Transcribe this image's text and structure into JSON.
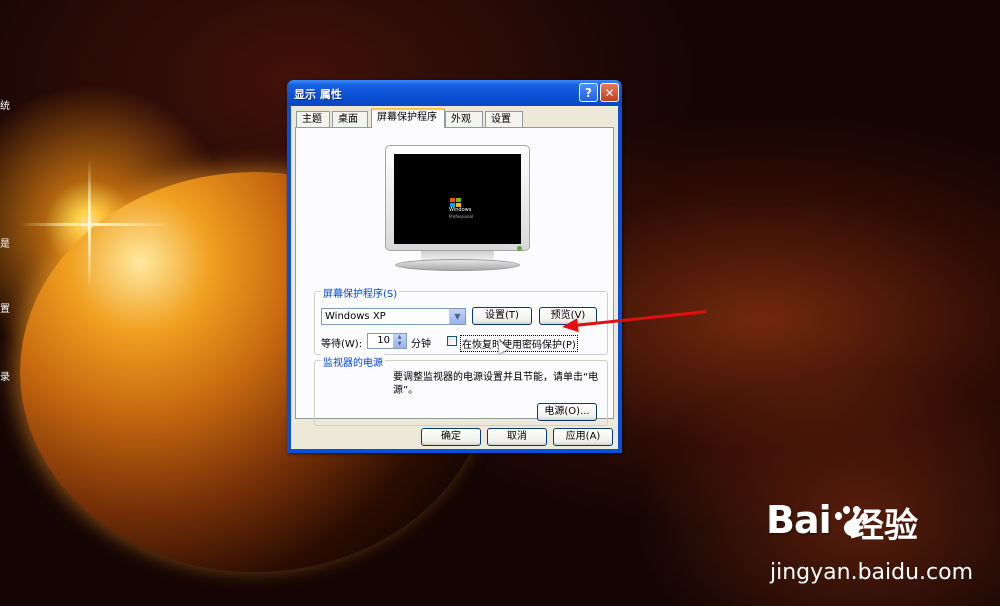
{
  "desktop": {
    "side_labels": [
      "统",
      "是",
      "置",
      "录"
    ]
  },
  "window": {
    "title": "显示 属性",
    "help_label": "?",
    "close_label": "✕",
    "tabs": [
      {
        "label": "主题",
        "active": false
      },
      {
        "label": "桌面",
        "active": false
      },
      {
        "label": "屏幕保护程序",
        "active": true
      },
      {
        "label": "外观",
        "active": false
      },
      {
        "label": "设置",
        "active": false
      }
    ]
  },
  "preview": {
    "os_text": "Windows",
    "os_sub": "Professional"
  },
  "screensaver": {
    "group_label": "屏幕保护程序(S)",
    "selected": "Windows XP",
    "settings_button": "设置(T)",
    "preview_button": "预览(V)",
    "wait_label": "等待(W):",
    "wait_value": "10",
    "wait_unit": "分钟",
    "password_checkbox": "在恢复时使用密码保护(P)",
    "password_checked": false
  },
  "power": {
    "group_label": "监视器的电源",
    "description": "要调整监视器的电源设置并且节能，请单击“电源”。",
    "power_button": "电源(O)..."
  },
  "footer": {
    "ok": "确定",
    "cancel": "取消",
    "apply": "应用(A)"
  },
  "watermark": {
    "brand_left": "Bai",
    "brand_right": "经验",
    "url": "jingyan.baidu.com"
  },
  "colors": {
    "title_bar": "#0a4ed2",
    "dialog_face": "#ece9d8",
    "group_label": "#0046d5",
    "annotation_arrow": "#e01010"
  }
}
